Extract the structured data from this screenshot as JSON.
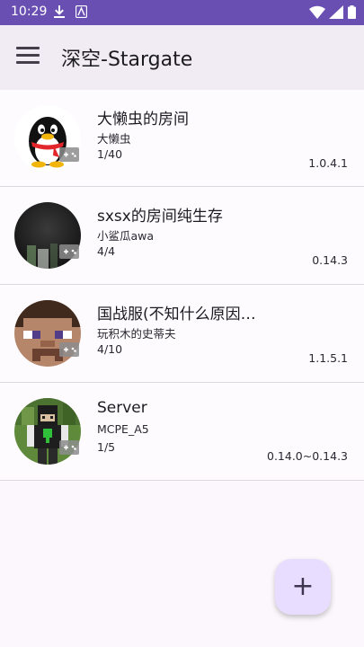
{
  "status_bar": {
    "time": "10:29"
  },
  "app_bar": {
    "title": "深空-Stargate"
  },
  "servers": [
    {
      "name": "大懒虫的房间",
      "owner": "大懒虫",
      "players": "1/40",
      "version": "1.0.4.1",
      "avatar": "qq-penguin"
    },
    {
      "name": "sxsx的房间纯生存",
      "owner": "小鲨瓜awa",
      "players": "4/4",
      "version": "0.14.3",
      "avatar": "dark-blurry"
    },
    {
      "name": "国战服(不知什么原因…",
      "owner": "玩积木的史蒂夫",
      "players": "4/10",
      "version": "1.1.5.1",
      "avatar": "minecraft-steve"
    },
    {
      "name": "Server",
      "owner": "MCPE_A5",
      "players": "1/5",
      "version": "0.14.0~0.14.3",
      "avatar": "minecraft-creeper-skin"
    }
  ],
  "colors": {
    "status_bar": "#6a4fb3",
    "app_bar": "#f1ecf4",
    "fab": "#e9ddff"
  },
  "fab": {
    "icon": "+"
  }
}
